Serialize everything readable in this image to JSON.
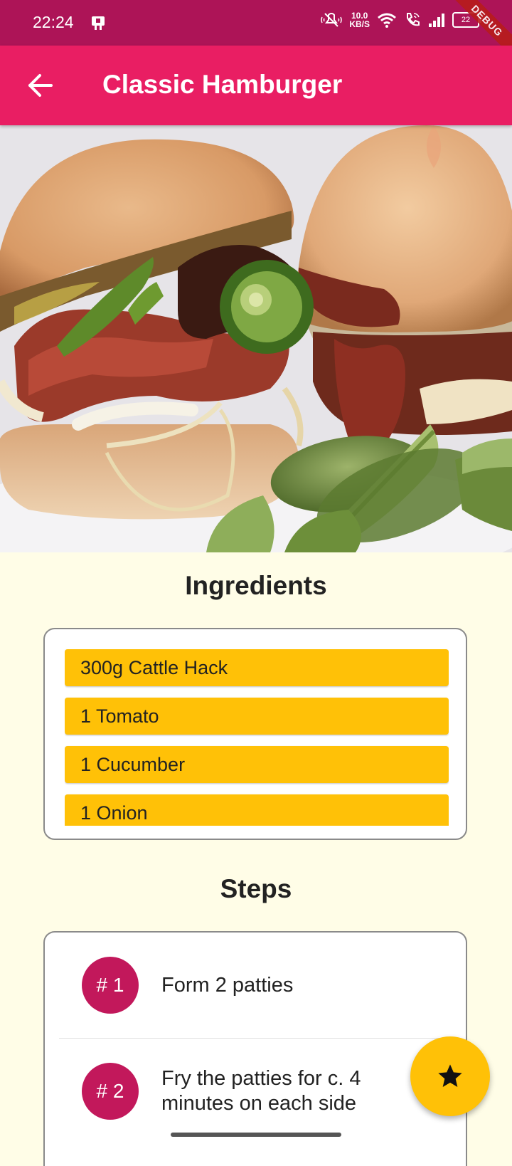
{
  "status_bar": {
    "time": "22:24",
    "net_speed_value": "10.0",
    "net_speed_unit": "KB/S",
    "battery": "22",
    "debug_label": "DEBUG",
    "background": "#AD1457",
    "icons": [
      "notification-icon",
      "mute-icon",
      "wifi-icon",
      "wifi-call-icon",
      "signal-icon",
      "battery-icon"
    ]
  },
  "app_bar": {
    "title": "Classic Hamburger",
    "background": "#E91E63",
    "back_icon": "arrow-back-icon"
  },
  "hero": {
    "image_icon": "hamburger-photo"
  },
  "ingredients": {
    "title": "Ingredients",
    "items": [
      "300g Cattle Hack",
      "1 Tomato",
      "1 Cucumber",
      "1 Onion"
    ]
  },
  "steps": {
    "title": "Steps",
    "items": [
      {
        "badge": "# 1",
        "text": "Form 2 patties"
      },
      {
        "badge": "# 2",
        "text": "Fry the patties for c. 4 minutes on each side"
      }
    ]
  },
  "fab": {
    "icon": "star-icon",
    "color": "#FFC107"
  },
  "colors": {
    "page_background": "#FFFDE7",
    "ingredient_chip": "#FFC107",
    "step_badge": "#C2185B"
  }
}
